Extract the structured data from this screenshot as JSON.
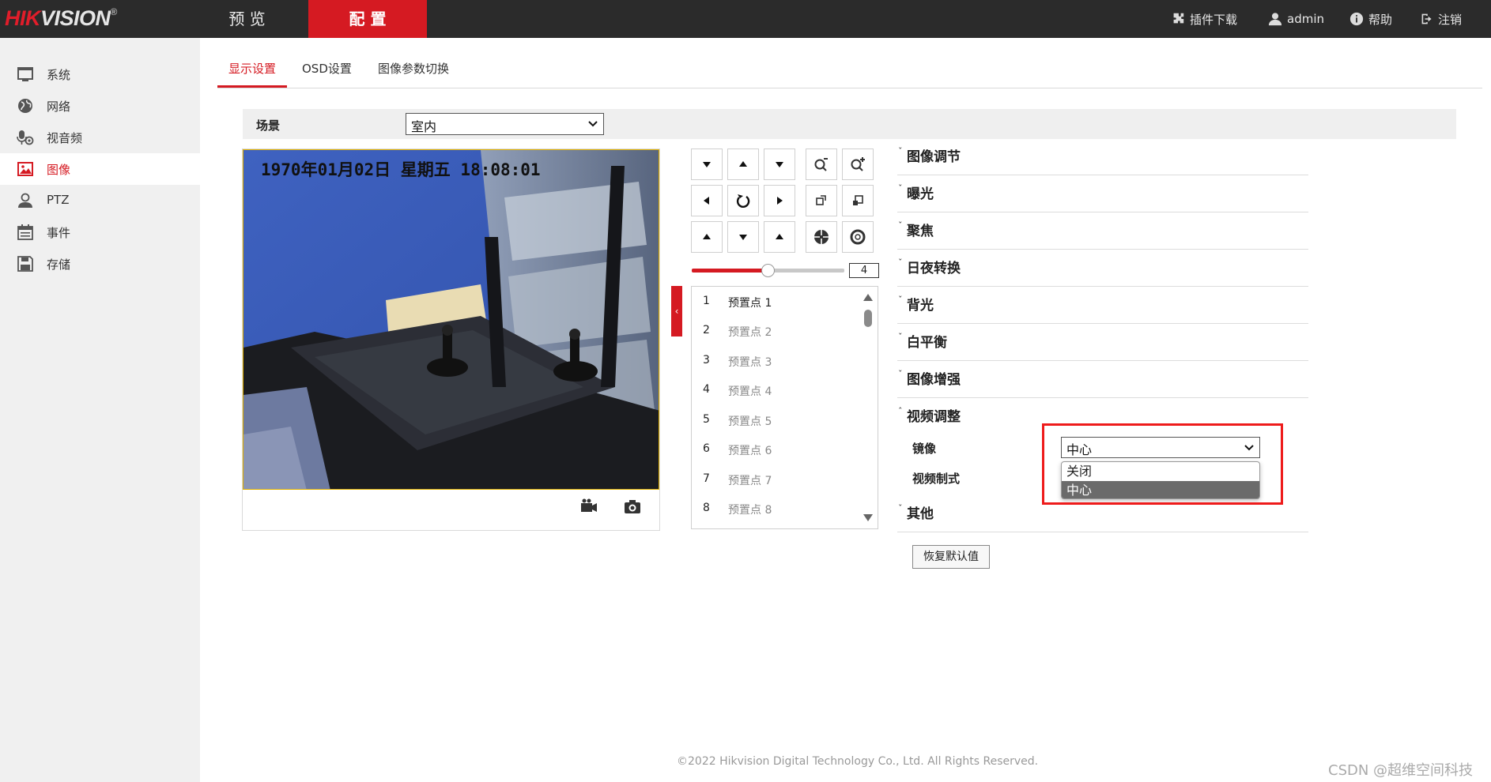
{
  "brand": {
    "logo_red": "HIK",
    "logo_white": "VISION",
    "registered": "®"
  },
  "topnav": {
    "preview": "预 览",
    "config": "配 置"
  },
  "toplinks": {
    "plugin": "插件下载",
    "user": "admin",
    "help": "帮助",
    "logout": "注销"
  },
  "sidebar": {
    "items": [
      {
        "label": "系统",
        "icon": "monitor-icon"
      },
      {
        "label": "网络",
        "icon": "globe-icon"
      },
      {
        "label": "视音频",
        "icon": "microphone-icon"
      },
      {
        "label": "图像",
        "icon": "image-icon"
      },
      {
        "label": "PTZ",
        "icon": "user-icon"
      },
      {
        "label": "事件",
        "icon": "calendar-icon"
      },
      {
        "label": "存储",
        "icon": "floppy-icon"
      }
    ],
    "active": "图像"
  },
  "subtabs": {
    "display": "显示设置",
    "osd": "OSD设置",
    "switch": "图像参数切换"
  },
  "scene": {
    "label": "场景",
    "value": "室内"
  },
  "video": {
    "osd_text": "1970年01月02日  星期五  18:08:01"
  },
  "ptz": {
    "speed": "4",
    "speed_fraction": 0.5
  },
  "presets": [
    {
      "num": "1",
      "name": "预置点 1"
    },
    {
      "num": "2",
      "name": "预置点 2"
    },
    {
      "num": "3",
      "name": "预置点 3"
    },
    {
      "num": "4",
      "name": "预置点 4"
    },
    {
      "num": "5",
      "name": "预置点 5"
    },
    {
      "num": "6",
      "name": "预置点 6"
    },
    {
      "num": "7",
      "name": "预置点 7"
    },
    {
      "num": "8",
      "name": "预置点 8"
    }
  ],
  "sections": {
    "image_adjust": "图像调节",
    "exposure": "曝光",
    "focus": "聚焦",
    "day_night": "日夜转换",
    "backlight": "背光",
    "white_balance": "白平衡",
    "enhance": "图像增强",
    "video_adjust": "视频调整",
    "other": "其他"
  },
  "video_adjust": {
    "mirror_label": "镜像",
    "mirror_value": "中心",
    "standard_label": "视频制式",
    "options": [
      "关闭",
      "中心"
    ]
  },
  "restore_button": "恢复默认值",
  "footer": "©2022 Hikvision Digital Technology Co., Ltd. All Rights Reserved.",
  "watermark": "CSDN @超维空间科技",
  "colors": {
    "accent": "#d51a22",
    "topbar": "#2b2b2b",
    "sidebar": "#f0f0f0",
    "highlight_frame": "#ee1b1b"
  }
}
